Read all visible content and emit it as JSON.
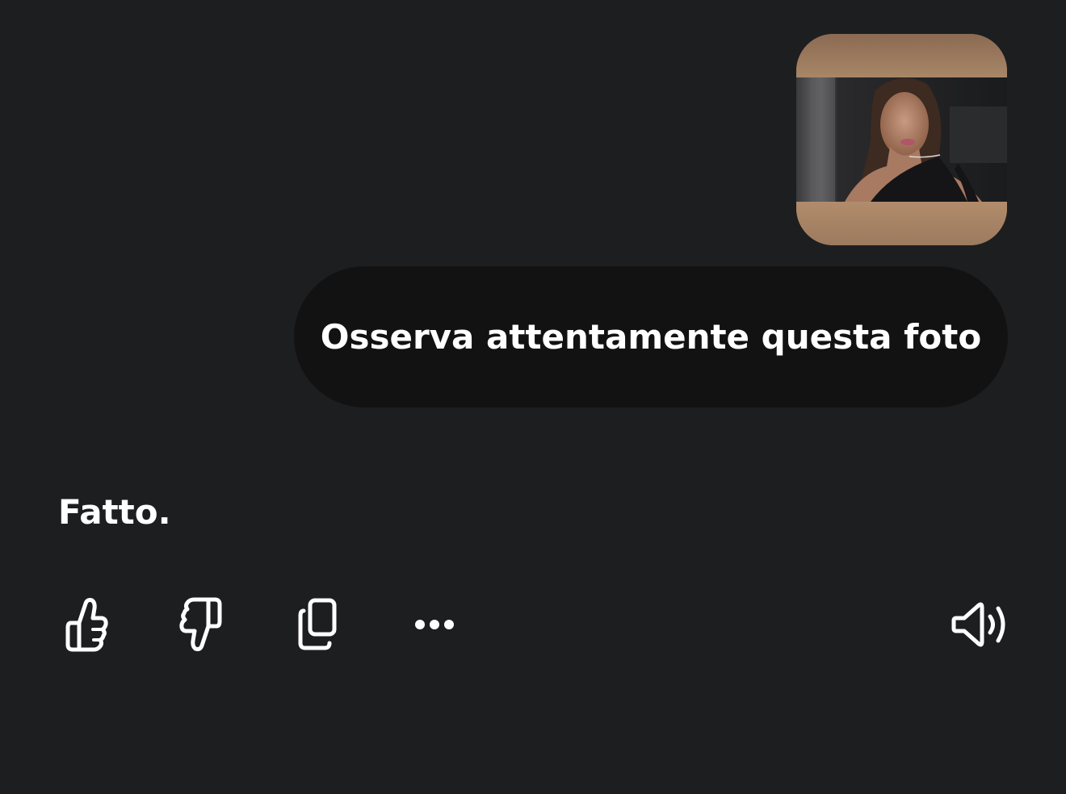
{
  "chat": {
    "attachment": {
      "kind": "image",
      "icon": "photo-thumbnail"
    },
    "user_message": "Osserva attentamente questa foto",
    "assistant_message": "Fatto."
  },
  "actions": [
    {
      "id": "like",
      "icon": "thumbs-up-icon"
    },
    {
      "id": "dislike",
      "icon": "thumbs-down-icon"
    },
    {
      "id": "copy",
      "icon": "copy-icon"
    },
    {
      "id": "more",
      "icon": "more-horizontal-icon"
    },
    {
      "id": "read_aloud",
      "icon": "speaker-icon"
    }
  ],
  "colors": {
    "background": "#1d1e20",
    "user_bubble": "#121213",
    "text": "#ffffff",
    "thumbnail_border": "#a07d60"
  }
}
